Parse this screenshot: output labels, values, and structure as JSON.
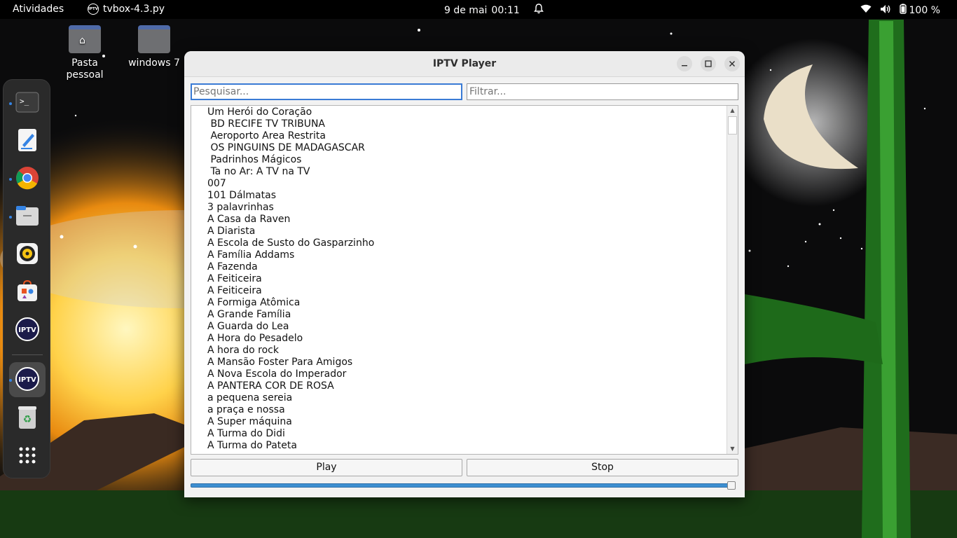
{
  "topbar": {
    "activities": "Atividades",
    "app_name": "tvbox-4.3.py",
    "app_icon_label": "IPTV",
    "date": "9 de mai",
    "time": "00:11",
    "battery": "100 %"
  },
  "desktop": {
    "icons": [
      {
        "label": "Pasta\npessoal"
      },
      {
        "label": "windows 7"
      }
    ]
  },
  "dock": {
    "items": [
      {
        "name": "terminal-icon"
      },
      {
        "name": "text-editor-icon"
      },
      {
        "name": "chrome-icon"
      },
      {
        "name": "files-icon"
      },
      {
        "name": "rhythmbox-icon"
      },
      {
        "name": "app-center-icon"
      },
      {
        "name": "iptv-icon",
        "label": "IPTV"
      },
      {
        "name": "iptv-running-icon",
        "label": "IPTV"
      },
      {
        "name": "trash-icon"
      },
      {
        "name": "show-apps-icon"
      }
    ]
  },
  "window": {
    "title": "IPTV Player",
    "search_placeholder": "Pesquisar...",
    "filter_placeholder": "Filtrar...",
    "play_label": "Play",
    "stop_label": "Stop",
    "progress": 1.0,
    "items": [
      "Um Herói do Coração",
      " BD RECIFE TV TRIBUNA",
      " Aeroporto Area Restrita",
      " OS PINGUINS DE MADAGASCAR",
      " Padrinhos Mágicos",
      " Ta no Ar: A TV na TV",
      "007",
      "101 Dálmatas",
      "3 palavrinhas",
      "A Casa da Raven",
      "A Diarista",
      "A Escola de Susto do Gasparzinho",
      "A Família Addams",
      "A Fazenda",
      "A Feiticeira",
      "A Feiticeira",
      "A Formiga Atômica",
      "A Grande Família",
      "A Guarda do Lea",
      "A Hora do Pesadelo",
      "A hora do rock",
      "A Mansão Foster Para Amigos",
      "A Nova Escola do Imperador",
      "A PANTERA COR DE ROSA",
      "a pequena sereia",
      "a praça e nossa",
      "A Super máquina",
      "A Turma do Didi",
      "A Turma do Pateta"
    ]
  }
}
